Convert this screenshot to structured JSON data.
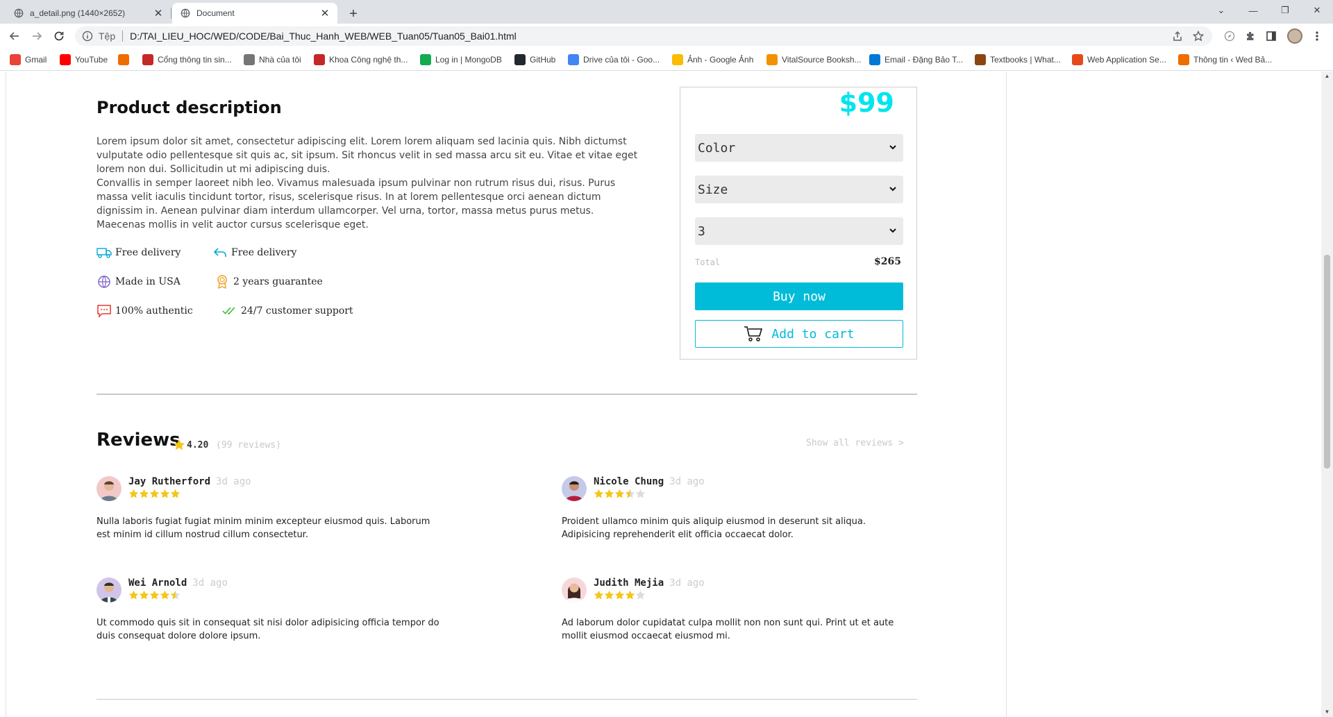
{
  "browser": {
    "tabs": [
      {
        "title": "a_detail.png (1440×2652)"
      },
      {
        "title": "Document"
      }
    ],
    "address": {
      "scheme": "Tệp",
      "url": "D:/TAI_LIEU_HOC/WED/CODE/Bai_Thuc_Hanh_WEB/WEB_Tuan05/Tuan05_Bai01.html"
    },
    "bookmarks": [
      {
        "label": "Gmail",
        "color": "#ea4335",
        "icon": "gmail-icon"
      },
      {
        "label": "YouTube",
        "color": "#ff0000",
        "icon": "youtube-icon"
      },
      {
        "label": "",
        "color": "#ef6c00",
        "icon": "bookmark-icon"
      },
      {
        "label": "Cổng thông tin sin...",
        "color": "#c62828",
        "icon": "site-icon"
      },
      {
        "label": "Nhà của tôi",
        "color": "#757575",
        "icon": "site-icon"
      },
      {
        "label": "Khoa Công nghệ th...",
        "color": "#c62828",
        "icon": "site-icon"
      },
      {
        "label": "Log in | MongoDB",
        "color": "#13aa52",
        "icon": "mongodb-icon"
      },
      {
        "label": "GitHub",
        "color": "#24292f",
        "icon": "github-icon"
      },
      {
        "label": "Drive của tôi - Goo...",
        "color": "#4285f4",
        "icon": "drive-icon"
      },
      {
        "label": "Ảnh - Google Ảnh",
        "color": "#fbbc04",
        "icon": "photos-icon"
      },
      {
        "label": "VitalSource Booksh...",
        "color": "#f29200",
        "icon": "site-icon"
      },
      {
        "label": "Email - Đặng Bảo T...",
        "color": "#0078d4",
        "icon": "outlook-icon"
      },
      {
        "label": "Textbooks | What...",
        "color": "#8b4513",
        "icon": "site-icon"
      },
      {
        "label": "Web Application Se...",
        "color": "#e64a19",
        "icon": "site-icon"
      },
      {
        "label": "Thông tin ‹ Wed Bả...",
        "color": "#ef6c00",
        "icon": "site-icon"
      }
    ]
  },
  "product": {
    "description_title": "Product description",
    "description_p1": "Lorem ipsum dolor sit amet, consectetur adipiscing elit. Lorem lorem aliquam sed lacinia quis. Nibh dictumst vulputate odio pellentesque sit quis ac, sit ipsum. Sit rhoncus velit in sed massa arcu sit eu. Vitae et vitae eget lorem non dui. Sollicitudin ut mi adipiscing duis.",
    "description_p2": "Convallis in semper laoreet nibh leo. Vivamus malesuada ipsum pulvinar non rutrum risus dui, risus. Purus massa velit iaculis tincidunt tortor, risus, scelerisque risus. In at lorem pellentesque orci aenean dictum dignissim in. Aenean pulvinar diam interdum ullamcorper. Vel urna, tortor, massa metus purus metus. Maecenas mollis in velit auctor cursus scelerisque eget.",
    "features": [
      {
        "label": "Free delivery",
        "icon": "truck-icon"
      },
      {
        "label": "Free delivery",
        "icon": "return-arrow-icon"
      },
      {
        "label": "Made in USA",
        "icon": "globe-icon"
      },
      {
        "label": "2 years guarantee",
        "icon": "award-icon"
      },
      {
        "label": "100% authentic",
        "icon": "chat-icon"
      },
      {
        "label": "24/7 customer support",
        "icon": "double-check-icon"
      }
    ]
  },
  "purchase": {
    "price": "$99",
    "color_select": "Color",
    "size_select": "Size",
    "quantity_select": "3",
    "total_label": "Total",
    "total_value": "$265",
    "buy_label": "Buy now",
    "cart_label": "Add to cart",
    "accent_color": "#00bcd8",
    "price_color": "#00e5ee"
  },
  "reviews": {
    "title": "Reviews",
    "rating": "4.20",
    "count": "(99 reviews)",
    "show_all": "Show all reviews >",
    "star_color": "#f5c518",
    "items": [
      {
        "name": "Jay Rutherford",
        "ago": "3d ago",
        "stars": 5,
        "text": "Nulla laboris fugiat fugiat minim minim excepteur eiusmod quis. Laborum est minim id cillum nostrud cillum consectetur."
      },
      {
        "name": "Nicole Chung",
        "ago": "3d ago",
        "stars": 3.5,
        "text": "Proident ullamco minim quis aliquip eiusmod in deserunt sit aliqua. Adipisicing reprehenderit elit officia occaecat dolor."
      },
      {
        "name": "Wei Arnold",
        "ago": "3d ago",
        "stars": 4.5,
        "text": "Ut commodo quis sit in consequat sit nisi dolor adipisicing officia tempor do duis consequat dolore dolore ipsum."
      },
      {
        "name": "Judith Mejia",
        "ago": "3d ago",
        "stars": 4,
        "text": "Ad laborum dolor cupidatat culpa mollit non non sunt qui. Print ut et aute mollit eiusmod occaecat eiusmod mi."
      }
    ]
  }
}
